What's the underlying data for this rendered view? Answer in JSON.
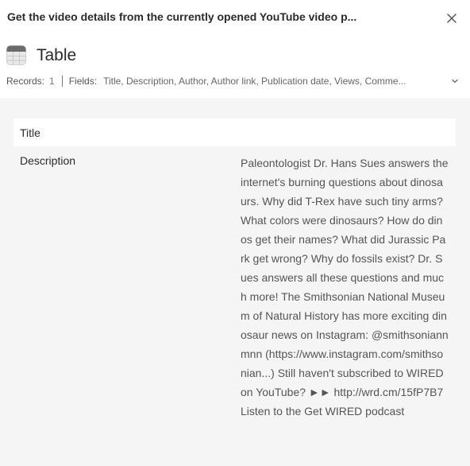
{
  "header": {
    "prompt_title": "Get the video details from the currently opened YouTube video p...",
    "table_title": "Table",
    "records_label": "Records:",
    "records_value": "1",
    "fields_label": "Fields:",
    "fields_value": "Title, Description, Author, Author link, Publication date, Views, Comme..."
  },
  "icons": {
    "close": "close-icon",
    "table": "table-icon",
    "expand": "chevron-down-icon"
  },
  "record": {
    "title_label": "Title",
    "description_label": "Description",
    "description_value": "Paleontologist Dr. Hans Sues answers the internet's burning questions about dinosaurs. Why did T-Rex have such tiny arms? What colors were dinosaurs? How do dinos get their names? What did Jurassic Park get wrong? Why do fossils exist? Dr. Sues answers all these questions and much more! The Smithsonian National Museum of Natural History has more exciting dinosaur news on Instagram: @smithsoniannmnn (https://www.instagram.com/smithsonian...) Still haven't subscribed to WIRED on YouTube? ►► http://wrd.cm/15fP7B7 Listen to the Get WIRED podcast"
  },
  "colors": {
    "content_bg": "#f5f5f5",
    "row_bg": "#ffffff",
    "icon_gray": "#6b6b6b"
  }
}
